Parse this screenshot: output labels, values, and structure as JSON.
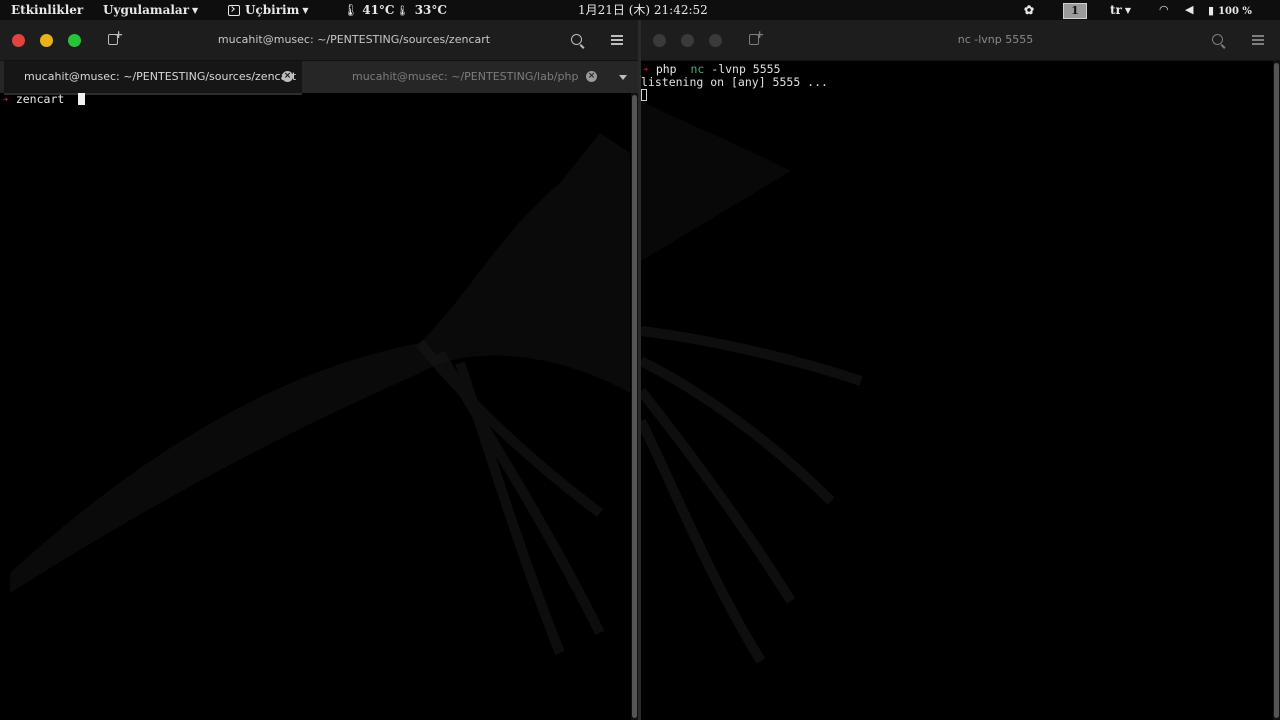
{
  "topbar": {
    "activities": "Etkinlikler",
    "applications": "Uygulamalar",
    "terminal": "Uçbirim",
    "cpu_temp": "41°C",
    "gpu_temp": "33°C",
    "clock": "1月21日 (木) 21:42:52",
    "workspace": "1",
    "language": "tr",
    "battery": "100 %"
  },
  "left_window": {
    "title": "mucahit@musec: ~/PENTESTING/sources/zencart",
    "tabs": [
      {
        "label": "mucahit@musec: ~/PENTESTING/sources/zencart",
        "active": true
      },
      {
        "label": "mucahit@musec: ~/PENTESTING/lab/php",
        "active": false
      }
    ],
    "prompt_dir": "zencart"
  },
  "right_window": {
    "title": "nc -lvnp 5555",
    "prompt_dir": "php",
    "command_name": "nc",
    "command_args": "-lvnp 5555",
    "output": "listening on [any] 5555 ..."
  },
  "colors": {
    "close": "#e0443e",
    "minimize": "#e9b11e",
    "maximize": "#28c23b",
    "prompt_arrow": "#c02a2a",
    "command": "#5aa86a"
  },
  "icons": [
    "terminal-icon",
    "thermometer-icon",
    "extensions-icon",
    "wifi-icon",
    "volume-icon",
    "battery-icon",
    "new-tab-icon",
    "search-icon",
    "menu-icon",
    "close-tab-icon",
    "tab-list-icon"
  ]
}
